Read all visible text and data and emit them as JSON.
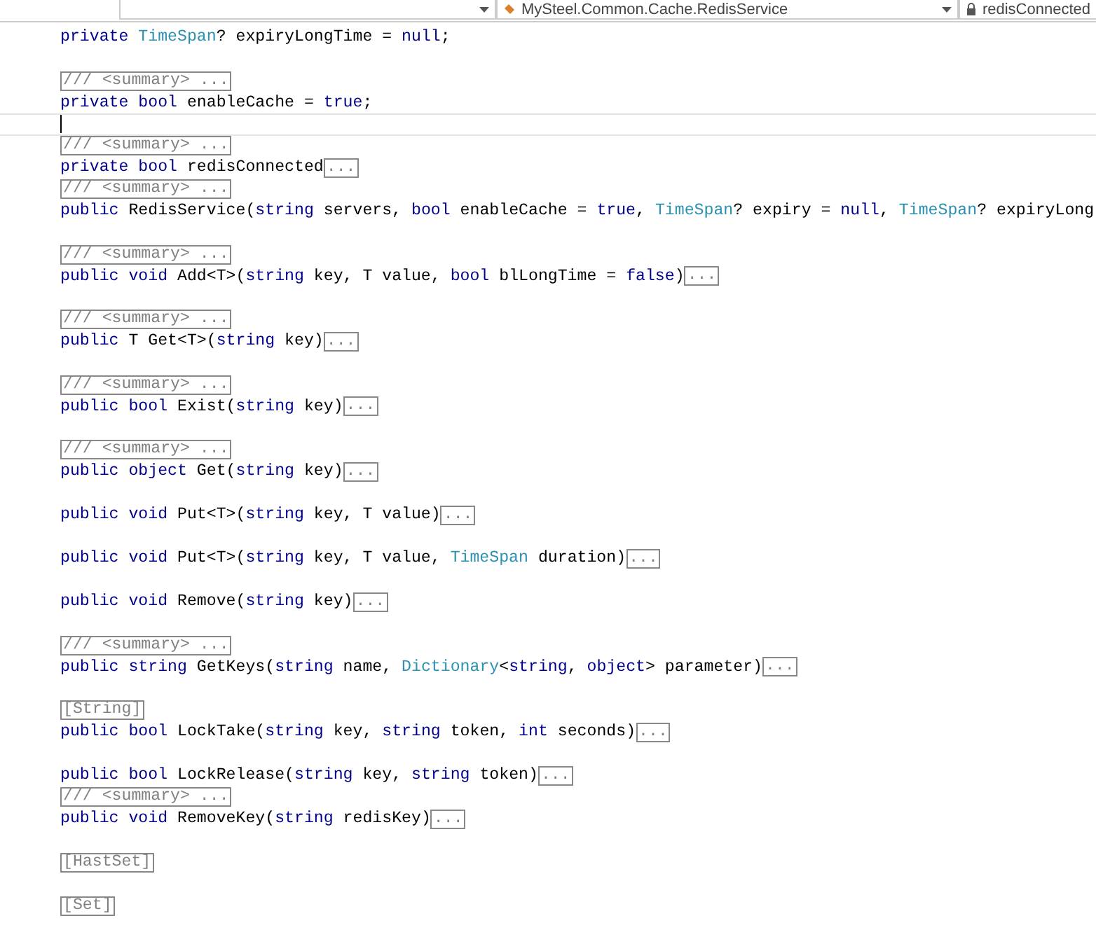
{
  "nav_bar": {
    "dropdowns": [
      {
        "kind": "plain"
      },
      {
        "label": "MySteel.Common.Cache.RedisService",
        "kind": "class"
      },
      {
        "label": "redisConnected",
        "kind": "member"
      }
    ]
  },
  "lines": [
    {
      "kind": "code",
      "segments": [
        {
          "kind": "kw",
          "t": "private "
        },
        {
          "kind": "type",
          "t": "TimeSpan"
        },
        {
          "kind": "text",
          "t": "? expiryLongTime = "
        },
        {
          "kind": "kw",
          "t": "null"
        },
        {
          "kind": "text",
          "t": ";"
        }
      ]
    },
    {
      "kind": "blank"
    },
    {
      "kind": "code",
      "segments": [
        {
          "kind": "fold",
          "t": "/// <summary> ..."
        }
      ]
    },
    {
      "kind": "code",
      "segments": [
        {
          "kind": "kw",
          "t": "private bool "
        },
        {
          "kind": "text",
          "t": "enableCache = "
        },
        {
          "kind": "kw",
          "t": "true"
        },
        {
          "kind": "text",
          "t": ";"
        }
      ]
    },
    {
      "kind": "caret"
    },
    {
      "kind": "code",
      "segments": [
        {
          "kind": "fold",
          "t": "/// <summary> ..."
        }
      ]
    },
    {
      "kind": "code",
      "segments": [
        {
          "kind": "kw",
          "t": "private bool "
        },
        {
          "kind": "text",
          "t": "redisConnected"
        },
        {
          "kind": "fold",
          "t": "..."
        }
      ]
    },
    {
      "kind": "code",
      "segments": [
        {
          "kind": "fold",
          "t": "/// <summary> ..."
        }
      ]
    },
    {
      "kind": "code",
      "segments": [
        {
          "kind": "kw",
          "t": "public "
        },
        {
          "kind": "text",
          "t": "RedisService("
        },
        {
          "kind": "kw",
          "t": "string "
        },
        {
          "kind": "text",
          "t": "servers, "
        },
        {
          "kind": "kw",
          "t": "bool "
        },
        {
          "kind": "text",
          "t": "enableCache = "
        },
        {
          "kind": "kw",
          "t": "true"
        },
        {
          "kind": "text",
          "t": ", "
        },
        {
          "kind": "type",
          "t": "TimeSpan"
        },
        {
          "kind": "text",
          "t": "? expiry = "
        },
        {
          "kind": "kw",
          "t": "null"
        },
        {
          "kind": "text",
          "t": ", "
        },
        {
          "kind": "type",
          "t": "TimeSpan"
        },
        {
          "kind": "text",
          "t": "? expiryLong"
        }
      ]
    },
    {
      "kind": "blank"
    },
    {
      "kind": "code",
      "segments": [
        {
          "kind": "fold",
          "t": "/// <summary> ..."
        }
      ]
    },
    {
      "kind": "code",
      "segments": [
        {
          "kind": "kw",
          "t": "public void "
        },
        {
          "kind": "text",
          "t": "Add<T>("
        },
        {
          "kind": "kw",
          "t": "string "
        },
        {
          "kind": "text",
          "t": "key, T value, "
        },
        {
          "kind": "kw",
          "t": "bool "
        },
        {
          "kind": "text",
          "t": "blLongTime = "
        },
        {
          "kind": "kw",
          "t": "false"
        },
        {
          "kind": "text",
          "t": ")"
        },
        {
          "kind": "fold",
          "t": "..."
        }
      ]
    },
    {
      "kind": "blank"
    },
    {
      "kind": "code",
      "segments": [
        {
          "kind": "fold",
          "t": "/// <summary> ..."
        }
      ]
    },
    {
      "kind": "code",
      "segments": [
        {
          "kind": "kw",
          "t": "public "
        },
        {
          "kind": "text",
          "t": "T Get<T>("
        },
        {
          "kind": "kw",
          "t": "string "
        },
        {
          "kind": "text",
          "t": "key)"
        },
        {
          "kind": "fold",
          "t": "..."
        }
      ]
    },
    {
      "kind": "blank"
    },
    {
      "kind": "code",
      "segments": [
        {
          "kind": "fold",
          "t": "/// <summary> ..."
        }
      ]
    },
    {
      "kind": "code",
      "segments": [
        {
          "kind": "kw",
          "t": "public bool "
        },
        {
          "kind": "text",
          "t": "Exist("
        },
        {
          "kind": "kw",
          "t": "string "
        },
        {
          "kind": "text",
          "t": "key)"
        },
        {
          "kind": "fold",
          "t": "..."
        }
      ]
    },
    {
      "kind": "blank"
    },
    {
      "kind": "code",
      "segments": [
        {
          "kind": "fold",
          "t": "/// <summary> ..."
        }
      ]
    },
    {
      "kind": "code",
      "segments": [
        {
          "kind": "kw",
          "t": "public object "
        },
        {
          "kind": "text",
          "t": "Get("
        },
        {
          "kind": "kw",
          "t": "string "
        },
        {
          "kind": "text",
          "t": "key)"
        },
        {
          "kind": "fold",
          "t": "..."
        }
      ]
    },
    {
      "kind": "blank"
    },
    {
      "kind": "code",
      "segments": [
        {
          "kind": "kw",
          "t": "public void "
        },
        {
          "kind": "text",
          "t": "Put<T>("
        },
        {
          "kind": "kw",
          "t": "string "
        },
        {
          "kind": "text",
          "t": "key, T value)"
        },
        {
          "kind": "fold",
          "t": "..."
        }
      ]
    },
    {
      "kind": "blank"
    },
    {
      "kind": "code",
      "segments": [
        {
          "kind": "kw",
          "t": "public void "
        },
        {
          "kind": "text",
          "t": "Put<T>("
        },
        {
          "kind": "kw",
          "t": "string "
        },
        {
          "kind": "text",
          "t": "key, T value, "
        },
        {
          "kind": "type",
          "t": "TimeSpan"
        },
        {
          "kind": "text",
          "t": " duration)"
        },
        {
          "kind": "fold",
          "t": "..."
        }
      ]
    },
    {
      "kind": "blank"
    },
    {
      "kind": "code",
      "segments": [
        {
          "kind": "kw",
          "t": "public void "
        },
        {
          "kind": "text",
          "t": "Remove("
        },
        {
          "kind": "kw",
          "t": "string "
        },
        {
          "kind": "text",
          "t": "key)"
        },
        {
          "kind": "fold",
          "t": "..."
        }
      ]
    },
    {
      "kind": "blank"
    },
    {
      "kind": "code",
      "segments": [
        {
          "kind": "fold",
          "t": "/// <summary> ..."
        }
      ]
    },
    {
      "kind": "code",
      "segments": [
        {
          "kind": "kw",
          "t": "public string "
        },
        {
          "kind": "text",
          "t": "GetKeys("
        },
        {
          "kind": "kw",
          "t": "string "
        },
        {
          "kind": "text",
          "t": "name, "
        },
        {
          "kind": "type",
          "t": "Dictionary"
        },
        {
          "kind": "text",
          "t": "<"
        },
        {
          "kind": "kw",
          "t": "string"
        },
        {
          "kind": "text",
          "t": ", "
        },
        {
          "kind": "kw",
          "t": "object"
        },
        {
          "kind": "text",
          "t": "> parameter)"
        },
        {
          "kind": "fold",
          "t": "..."
        }
      ]
    },
    {
      "kind": "blank"
    },
    {
      "kind": "code",
      "segments": [
        {
          "kind": "fold",
          "t": "[String]"
        }
      ]
    },
    {
      "kind": "code",
      "segments": [
        {
          "kind": "kw",
          "t": "public bool "
        },
        {
          "kind": "text",
          "t": "LockTake("
        },
        {
          "kind": "kw",
          "t": "string "
        },
        {
          "kind": "text",
          "t": "key, "
        },
        {
          "kind": "kw",
          "t": "string "
        },
        {
          "kind": "text",
          "t": "token, "
        },
        {
          "kind": "kw",
          "t": "int "
        },
        {
          "kind": "text",
          "t": "seconds)"
        },
        {
          "kind": "fold",
          "t": "..."
        }
      ]
    },
    {
      "kind": "blank"
    },
    {
      "kind": "code",
      "segments": [
        {
          "kind": "kw",
          "t": "public bool "
        },
        {
          "kind": "text",
          "t": "LockRelease("
        },
        {
          "kind": "kw",
          "t": "string "
        },
        {
          "kind": "text",
          "t": "key, "
        },
        {
          "kind": "kw",
          "t": "string "
        },
        {
          "kind": "text",
          "t": "token)"
        },
        {
          "kind": "fold",
          "t": "..."
        }
      ]
    },
    {
      "kind": "code",
      "segments": [
        {
          "kind": "fold",
          "t": "/// <summary> ..."
        }
      ]
    },
    {
      "kind": "code",
      "segments": [
        {
          "kind": "kw",
          "t": "public void "
        },
        {
          "kind": "text",
          "t": "RemoveKey("
        },
        {
          "kind": "kw",
          "t": "string "
        },
        {
          "kind": "text",
          "t": "redisKey)"
        },
        {
          "kind": "fold",
          "t": "..."
        }
      ]
    },
    {
      "kind": "blank"
    },
    {
      "kind": "code",
      "segments": [
        {
          "kind": "fold",
          "t": "[HastSet]"
        }
      ]
    },
    {
      "kind": "blank"
    },
    {
      "kind": "code",
      "segments": [
        {
          "kind": "fold",
          "t": "[Set]"
        }
      ]
    }
  ]
}
